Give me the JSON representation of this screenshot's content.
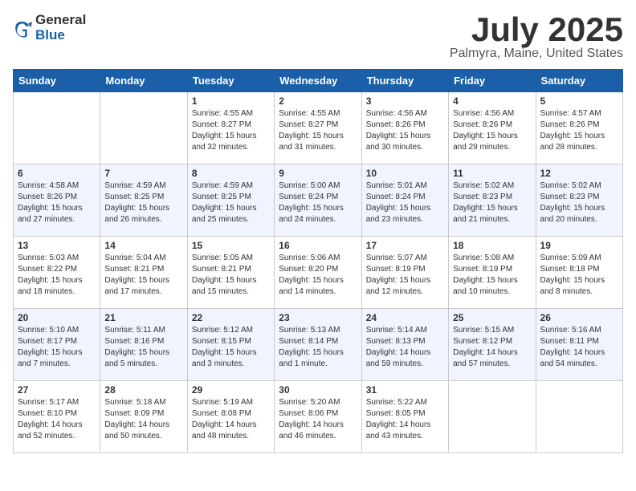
{
  "header": {
    "logo_general": "General",
    "logo_blue": "Blue",
    "month": "July 2025",
    "location": "Palmyra, Maine, United States"
  },
  "weekdays": [
    "Sunday",
    "Monday",
    "Tuesday",
    "Wednesday",
    "Thursday",
    "Friday",
    "Saturday"
  ],
  "weeks": [
    [
      {
        "day": "",
        "sunrise": "",
        "sunset": "",
        "daylight": ""
      },
      {
        "day": "",
        "sunrise": "",
        "sunset": "",
        "daylight": ""
      },
      {
        "day": "1",
        "sunrise": "Sunrise: 4:55 AM",
        "sunset": "Sunset: 8:27 PM",
        "daylight": "Daylight: 15 hours and 32 minutes."
      },
      {
        "day": "2",
        "sunrise": "Sunrise: 4:55 AM",
        "sunset": "Sunset: 8:27 PM",
        "daylight": "Daylight: 15 hours and 31 minutes."
      },
      {
        "day": "3",
        "sunrise": "Sunrise: 4:56 AM",
        "sunset": "Sunset: 8:26 PM",
        "daylight": "Daylight: 15 hours and 30 minutes."
      },
      {
        "day": "4",
        "sunrise": "Sunrise: 4:56 AM",
        "sunset": "Sunset: 8:26 PM",
        "daylight": "Daylight: 15 hours and 29 minutes."
      },
      {
        "day": "5",
        "sunrise": "Sunrise: 4:57 AM",
        "sunset": "Sunset: 8:26 PM",
        "daylight": "Daylight: 15 hours and 28 minutes."
      }
    ],
    [
      {
        "day": "6",
        "sunrise": "Sunrise: 4:58 AM",
        "sunset": "Sunset: 8:26 PM",
        "daylight": "Daylight: 15 hours and 27 minutes."
      },
      {
        "day": "7",
        "sunrise": "Sunrise: 4:59 AM",
        "sunset": "Sunset: 8:25 PM",
        "daylight": "Daylight: 15 hours and 26 minutes."
      },
      {
        "day": "8",
        "sunrise": "Sunrise: 4:59 AM",
        "sunset": "Sunset: 8:25 PM",
        "daylight": "Daylight: 15 hours and 25 minutes."
      },
      {
        "day": "9",
        "sunrise": "Sunrise: 5:00 AM",
        "sunset": "Sunset: 8:24 PM",
        "daylight": "Daylight: 15 hours and 24 minutes."
      },
      {
        "day": "10",
        "sunrise": "Sunrise: 5:01 AM",
        "sunset": "Sunset: 8:24 PM",
        "daylight": "Daylight: 15 hours and 23 minutes."
      },
      {
        "day": "11",
        "sunrise": "Sunrise: 5:02 AM",
        "sunset": "Sunset: 8:23 PM",
        "daylight": "Daylight: 15 hours and 21 minutes."
      },
      {
        "day": "12",
        "sunrise": "Sunrise: 5:02 AM",
        "sunset": "Sunset: 8:23 PM",
        "daylight": "Daylight: 15 hours and 20 minutes."
      }
    ],
    [
      {
        "day": "13",
        "sunrise": "Sunrise: 5:03 AM",
        "sunset": "Sunset: 8:22 PM",
        "daylight": "Daylight: 15 hours and 18 minutes."
      },
      {
        "day": "14",
        "sunrise": "Sunrise: 5:04 AM",
        "sunset": "Sunset: 8:21 PM",
        "daylight": "Daylight: 15 hours and 17 minutes."
      },
      {
        "day": "15",
        "sunrise": "Sunrise: 5:05 AM",
        "sunset": "Sunset: 8:21 PM",
        "daylight": "Daylight: 15 hours and 15 minutes."
      },
      {
        "day": "16",
        "sunrise": "Sunrise: 5:06 AM",
        "sunset": "Sunset: 8:20 PM",
        "daylight": "Daylight: 15 hours and 14 minutes."
      },
      {
        "day": "17",
        "sunrise": "Sunrise: 5:07 AM",
        "sunset": "Sunset: 8:19 PM",
        "daylight": "Daylight: 15 hours and 12 minutes."
      },
      {
        "day": "18",
        "sunrise": "Sunrise: 5:08 AM",
        "sunset": "Sunset: 8:19 PM",
        "daylight": "Daylight: 15 hours and 10 minutes."
      },
      {
        "day": "19",
        "sunrise": "Sunrise: 5:09 AM",
        "sunset": "Sunset: 8:18 PM",
        "daylight": "Daylight: 15 hours and 8 minutes."
      }
    ],
    [
      {
        "day": "20",
        "sunrise": "Sunrise: 5:10 AM",
        "sunset": "Sunset: 8:17 PM",
        "daylight": "Daylight: 15 hours and 7 minutes."
      },
      {
        "day": "21",
        "sunrise": "Sunrise: 5:11 AM",
        "sunset": "Sunset: 8:16 PM",
        "daylight": "Daylight: 15 hours and 5 minutes."
      },
      {
        "day": "22",
        "sunrise": "Sunrise: 5:12 AM",
        "sunset": "Sunset: 8:15 PM",
        "daylight": "Daylight: 15 hours and 3 minutes."
      },
      {
        "day": "23",
        "sunrise": "Sunrise: 5:13 AM",
        "sunset": "Sunset: 8:14 PM",
        "daylight": "Daylight: 15 hours and 1 minute."
      },
      {
        "day": "24",
        "sunrise": "Sunrise: 5:14 AM",
        "sunset": "Sunset: 8:13 PM",
        "daylight": "Daylight: 14 hours and 59 minutes."
      },
      {
        "day": "25",
        "sunrise": "Sunrise: 5:15 AM",
        "sunset": "Sunset: 8:12 PM",
        "daylight": "Daylight: 14 hours and 57 minutes."
      },
      {
        "day": "26",
        "sunrise": "Sunrise: 5:16 AM",
        "sunset": "Sunset: 8:11 PM",
        "daylight": "Daylight: 14 hours and 54 minutes."
      }
    ],
    [
      {
        "day": "27",
        "sunrise": "Sunrise: 5:17 AM",
        "sunset": "Sunset: 8:10 PM",
        "daylight": "Daylight: 14 hours and 52 minutes."
      },
      {
        "day": "28",
        "sunrise": "Sunrise: 5:18 AM",
        "sunset": "Sunset: 8:09 PM",
        "daylight": "Daylight: 14 hours and 50 minutes."
      },
      {
        "day": "29",
        "sunrise": "Sunrise: 5:19 AM",
        "sunset": "Sunset: 8:08 PM",
        "daylight": "Daylight: 14 hours and 48 minutes."
      },
      {
        "day": "30",
        "sunrise": "Sunrise: 5:20 AM",
        "sunset": "Sunset: 8:06 PM",
        "daylight": "Daylight: 14 hours and 46 minutes."
      },
      {
        "day": "31",
        "sunrise": "Sunrise: 5:22 AM",
        "sunset": "Sunset: 8:05 PM",
        "daylight": "Daylight: 14 hours and 43 minutes."
      },
      {
        "day": "",
        "sunrise": "",
        "sunset": "",
        "daylight": ""
      },
      {
        "day": "",
        "sunrise": "",
        "sunset": "",
        "daylight": ""
      }
    ]
  ]
}
